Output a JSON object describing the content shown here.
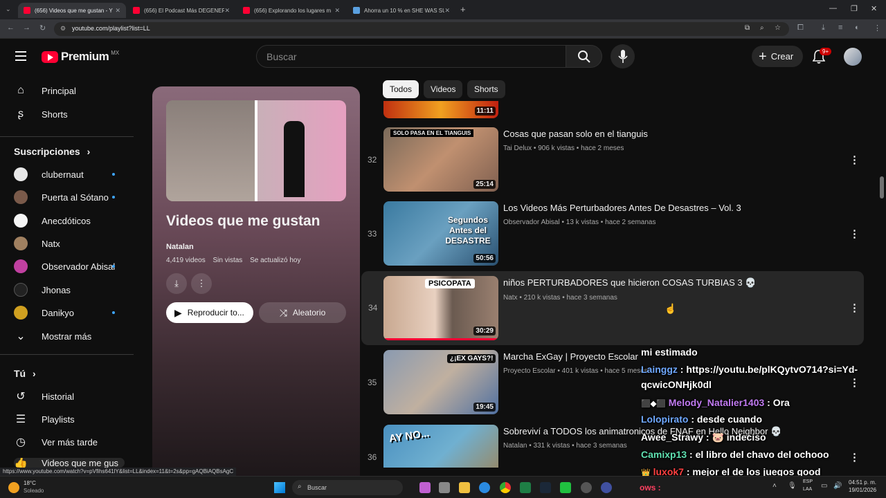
{
  "browser": {
    "tabs": [
      {
        "title": "(656) Videos que me gustan - Y",
        "active": true
      },
      {
        "title": "(656) El Podcast Más DEGENER",
        "active": false
      },
      {
        "title": "(656) Explorando los lugares m",
        "active": false
      },
      {
        "title": "Ahorra un 10 % en SHE WAS SU",
        "active": false
      }
    ],
    "new_tab": "+",
    "url": "youtube.com/playlist?list=LL"
  },
  "header": {
    "logo_text": "Premium",
    "region": "MX",
    "search_placeholder": "Buscar",
    "create_label": "Crear",
    "notifications_badge": "9+"
  },
  "sidebar": {
    "main": [
      {
        "label": "Principal",
        "icon": "home-icon"
      },
      {
        "label": "Shorts",
        "icon": "shorts-icon"
      }
    ],
    "subs_header": "Suscripciones",
    "subscriptions": [
      {
        "label": "clubernaut",
        "dot": true,
        "color": "#e8e8e8"
      },
      {
        "label": "Puerta al Sótano",
        "dot": true,
        "color": "#7a5a4a"
      },
      {
        "label": "Anecdóticos",
        "dot": false,
        "color": "#f5f5f5"
      },
      {
        "label": "Natx",
        "dot": false,
        "color": "#a08060"
      },
      {
        "label": "Observador Abisal",
        "dot": true,
        "color": "#c040a0"
      },
      {
        "label": "Jhonas",
        "dot": false,
        "color": "#222222"
      },
      {
        "label": "Danikyo",
        "dot": true,
        "color": "#d0a020"
      }
    ],
    "show_more": "Mostrar más",
    "you_header": "Tú",
    "you": [
      {
        "label": "Historial"
      },
      {
        "label": "Playlists"
      },
      {
        "label": "Ver más tarde"
      },
      {
        "label": "Videos que me gus"
      }
    ]
  },
  "playlist": {
    "title": "Videos que me gustan",
    "owner": "Natalan",
    "count": "4,419 videos",
    "views": "Sin vistas",
    "updated": "Se actualizó hoy",
    "play_all": "Reproducir to...",
    "shuffle": "Aleatorio"
  },
  "chips": [
    "Todos",
    "Videos",
    "Shorts"
  ],
  "videos": [
    {
      "idx": "",
      "title": "",
      "channel": "",
      "views": "",
      "age": "",
      "duration": "11:11"
    },
    {
      "idx": "32",
      "title": "Cosas que pasan solo en el tianguis",
      "channel": "Tai Delux",
      "views": "906 k vistas",
      "age": "hace 2 meses",
      "duration": "25:14",
      "thumb_text": "SOLO PASA EN EL TIANGUIS"
    },
    {
      "idx": "33",
      "title": "Los Videos Más Perturbadores Antes De Desastres – Vol. 3",
      "channel": "Observador Abisal",
      "views": "13 k vistas",
      "age": "hace 2 semanas",
      "duration": "50:56",
      "thumb_text": "Segundos Antes del DESASTRE"
    },
    {
      "idx": "34",
      "title": "niños PERTURBADORES que hicieron COSAS TURBIAS 3 💀",
      "channel": "Natx",
      "views": "210 k vistas",
      "age": "hace 3 semanas",
      "duration": "30:29",
      "thumb_text": "PSICOPATA"
    },
    {
      "idx": "35",
      "title": "Marcha ExGay | Proyecto Escolar",
      "channel": "Proyecto Escolar",
      "views": "401 k vistas",
      "age": "hace 5 meses",
      "duration": "19:45",
      "thumb_text": "¿¡EX GAYS?!"
    },
    {
      "idx": "36",
      "title": "Sobreviví a TODOS los animatronicos de FNAF en Hello Neighbor 💀",
      "channel": "Natalan",
      "views": "331 k vistas",
      "age": "hace 3 semanas",
      "duration": "",
      "thumb_text": "AY NO..."
    }
  ],
  "chat": [
    {
      "user": "",
      "text": "mi estimado",
      "color": "#ffffff"
    },
    {
      "user": "Lainggz",
      "text": ": https://youtu.be/plKQytvO714?si=Yd-",
      "color": "#6fa8ff"
    },
    {
      "user": "",
      "text": "qcwicONHjk0dl",
      "color": "#ffffff"
    },
    {
      "user": "Melody_Natalier1403",
      "text": ": Ora",
      "color": "#c07af0"
    },
    {
      "user": "Lolopirato",
      "text": ": desde cuando",
      "color": "#6fa8ff"
    },
    {
      "user": "Awee_Strawy",
      "text": ": 🐷 indeciso",
      "color": "#ffffff"
    },
    {
      "user": "Camixp13",
      "text": ": el libro del chavo del ochooo",
      "color": "#5fe0b0"
    },
    {
      "user": "luxok7",
      "text": ": mejor el de los juegos good",
      "color": "#ff4040"
    }
  ],
  "status_url": "https://www.youtube.com/watch?v=pVfihs641lY&list=LL&index=11&t=2s&pp=gAQBiAQBsAgC",
  "taskbar": {
    "weather_temp": "18°C",
    "weather_desc": "Soleado",
    "search": "Buscar",
    "lang": "ESP",
    "lang2": "LAA",
    "time": "04:51 p. m.",
    "date": "19/01/2026",
    "ows": "ows :"
  }
}
